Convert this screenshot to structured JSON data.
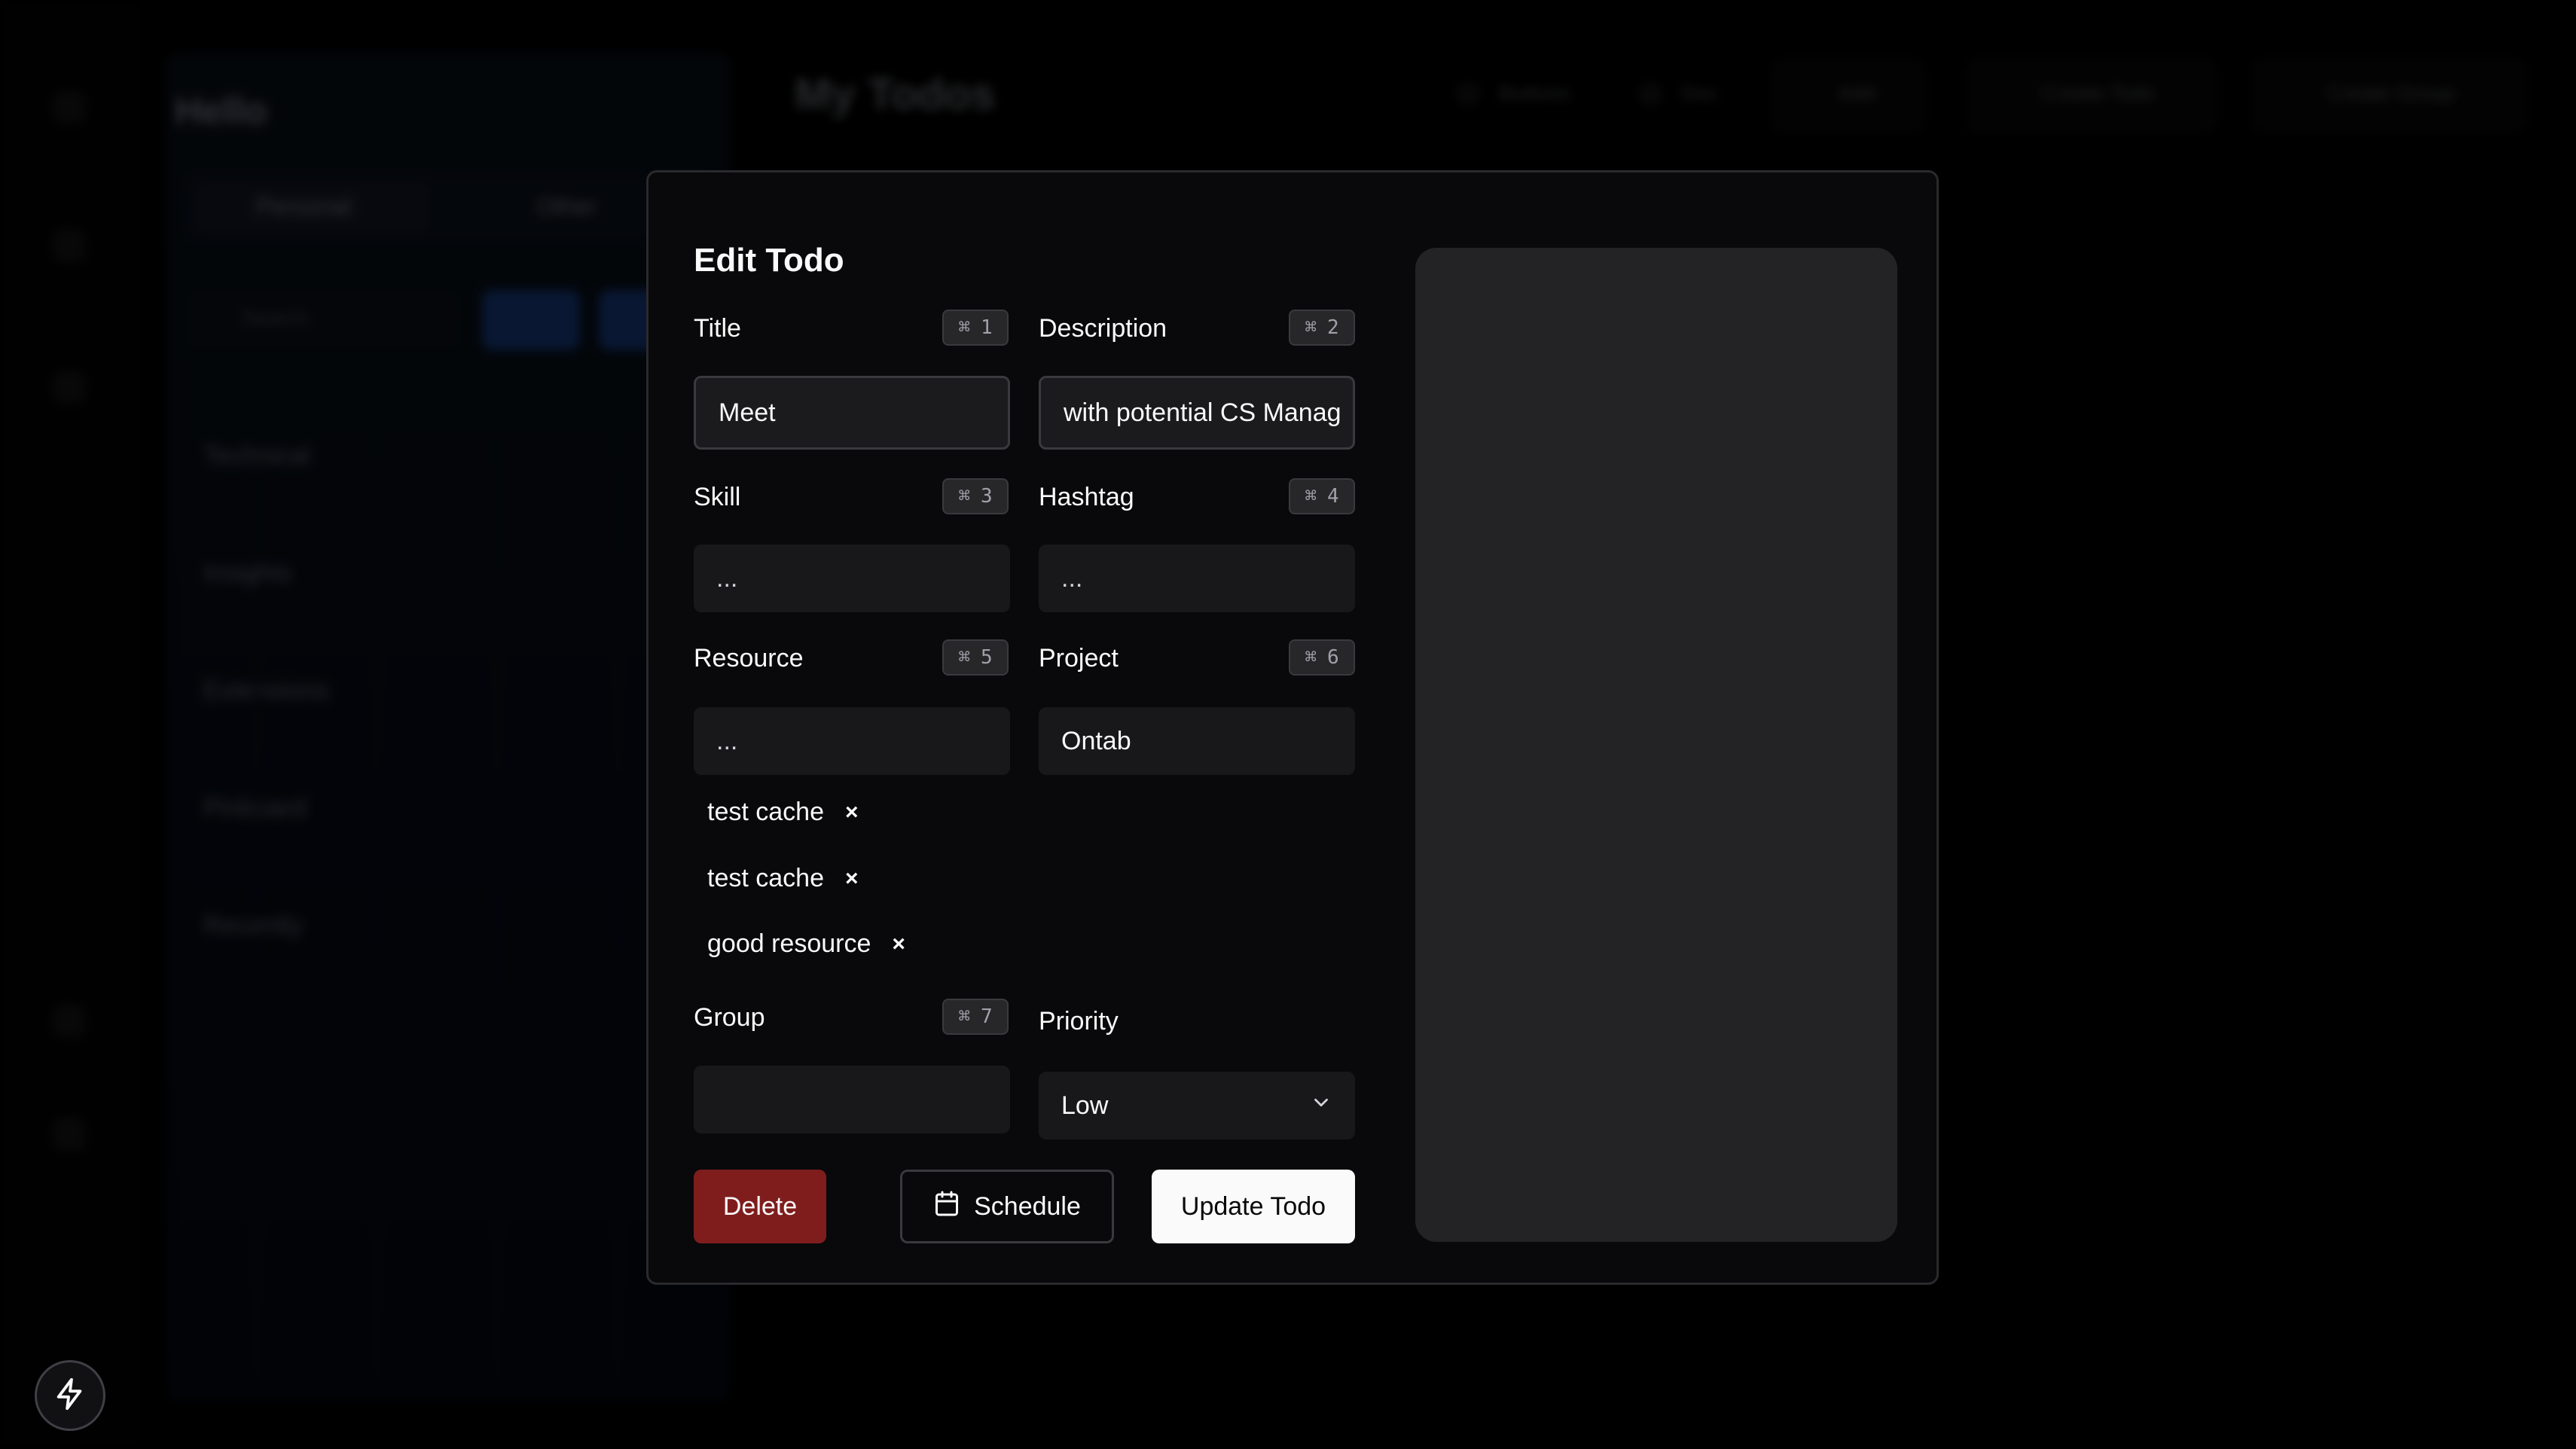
{
  "background": {
    "sidebar_title": "Hello",
    "tabs": [
      {
        "label": "Personal"
      },
      {
        "label": "Other"
      }
    ],
    "search_placeholder": "Search",
    "list_items": [
      "Technical",
      "Insights",
      "Extensions",
      "Pinboard",
      "Recently"
    ],
    "header_title": "My Todos",
    "header_actions": [
      "Buttons",
      "Doc",
      "Add",
      "Create Todo",
      "Create Group"
    ]
  },
  "modal": {
    "title": "Edit Todo",
    "fields": {
      "title": {
        "label": "Title",
        "shortcut": "1",
        "value": "Meet"
      },
      "description": {
        "label": "Description",
        "shortcut": "2",
        "value": "with potential CS Manag"
      },
      "skill": {
        "label": "Skill",
        "shortcut": "3",
        "placeholder": "..."
      },
      "hashtag": {
        "label": "Hashtag",
        "shortcut": "4",
        "placeholder": "..."
      },
      "resource": {
        "label": "Resource",
        "shortcut": "5",
        "placeholder": "..."
      },
      "project": {
        "label": "Project",
        "shortcut": "6",
        "value": "Ontab"
      },
      "group": {
        "label": "Group",
        "shortcut": "7",
        "value": ""
      },
      "priority": {
        "label": "Priority",
        "value": "Low"
      }
    },
    "shortcut_modifier": "⌘",
    "resource_tags": [
      {
        "label": "test cache",
        "remove": "×"
      },
      {
        "label": "test cache",
        "remove": "×"
      },
      {
        "label": "good resource",
        "remove": "×"
      }
    ],
    "buttons": {
      "delete": "Delete",
      "schedule": "Schedule",
      "update": "Update Todo"
    }
  },
  "colors": {
    "delete": "#7f1d1d",
    "update_bg": "#fafafa",
    "panel": "#232325"
  }
}
